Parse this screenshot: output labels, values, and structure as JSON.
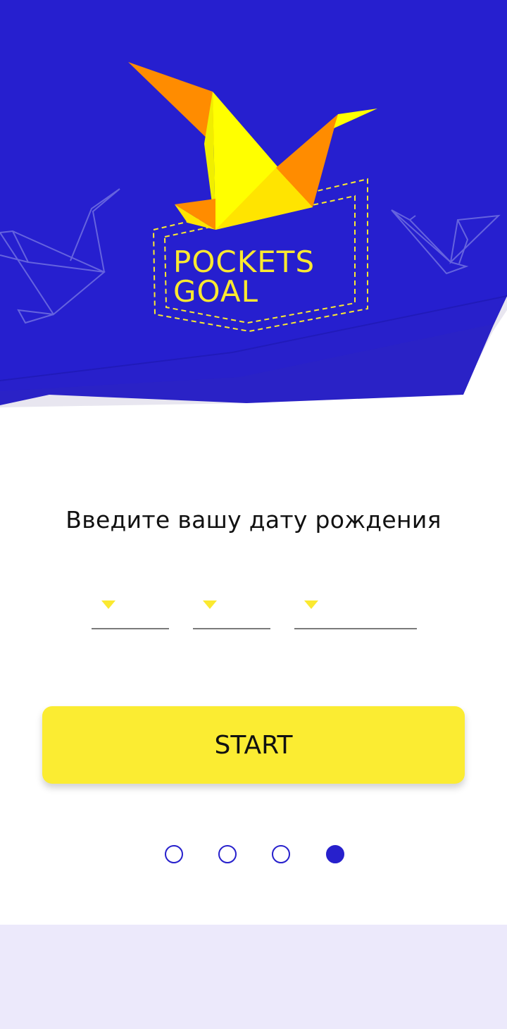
{
  "app": {
    "logo_line1": "POCKETS",
    "logo_line2": "GOAL"
  },
  "main": {
    "prompt": "Введите вашу дату рождения"
  },
  "date_fields": {
    "day": "",
    "month": "",
    "year": ""
  },
  "start_button": {
    "label": "START"
  },
  "pager": {
    "page_count": 4,
    "current_page": 4
  },
  "colors": {
    "brand_blue": "#2720cc",
    "accent_yellow": "#fbec32",
    "accent_orange": "#ff8c00",
    "bird_yellow": "#ffff00",
    "bottom_band": "#ece9fb"
  },
  "icons": {
    "logo": "origami-bird-logo",
    "decor_left": "origami-bird-outline",
    "decor_right": "origami-bird-outline",
    "dropdown": "triangle-down-icon"
  }
}
